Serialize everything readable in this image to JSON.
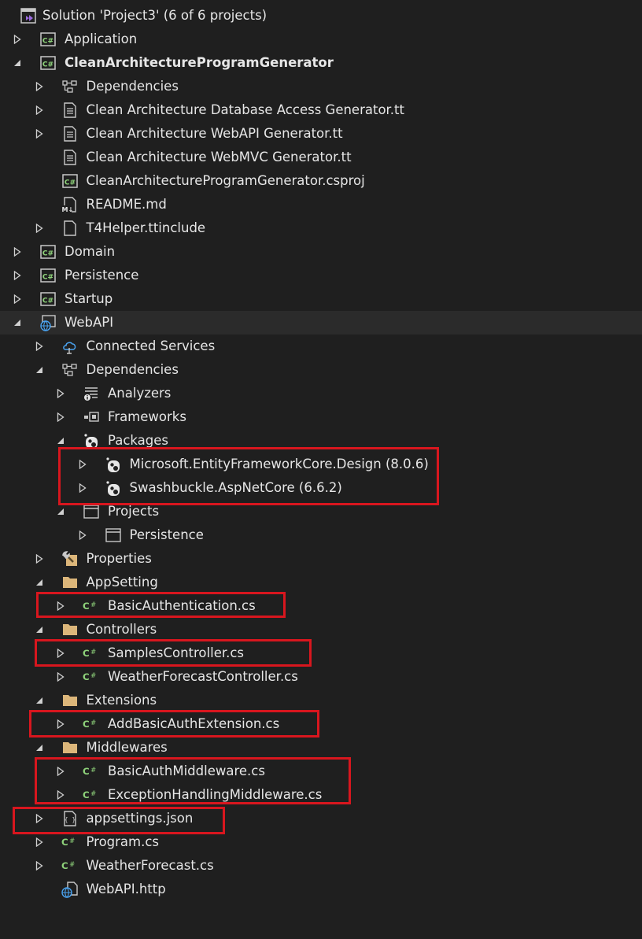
{
  "solution": {
    "label": "Solution 'Project3' (6 of 6 projects)"
  },
  "tree": [
    {
      "label": "Application",
      "indent": 1,
      "icon": "csharp-project-icon",
      "arrow": "collapsed"
    },
    {
      "label": "CleanArchitectureProgramGenerator",
      "indent": 1,
      "icon": "csharp-project-icon",
      "arrow": "expanded",
      "bold": true
    },
    {
      "label": "Dependencies",
      "indent": 2,
      "icon": "dependencies-icon",
      "arrow": "collapsed"
    },
    {
      "label": "Clean Architecture Database Access Generator.tt",
      "indent": 2,
      "icon": "text-template-icon",
      "arrow": "collapsed"
    },
    {
      "label": "Clean Architecture WebAPI Generator.tt",
      "indent": 2,
      "icon": "text-template-icon",
      "arrow": "collapsed"
    },
    {
      "label": "Clean Architecture WebMVC Generator.tt",
      "indent": 2,
      "icon": "text-template-icon",
      "arrow": "none"
    },
    {
      "label": "CleanArchitectureProgramGenerator.csproj",
      "indent": 2,
      "icon": "csharp-project-icon",
      "arrow": "none"
    },
    {
      "label": "README.md",
      "indent": 2,
      "icon": "markdown-icon",
      "arrow": "none"
    },
    {
      "label": "T4Helper.ttinclude",
      "indent": 2,
      "icon": "file-icon",
      "arrow": "collapsed"
    },
    {
      "label": "Domain",
      "indent": 1,
      "icon": "csharp-project-icon",
      "arrow": "collapsed"
    },
    {
      "label": "Persistence",
      "indent": 1,
      "icon": "csharp-project-icon",
      "arrow": "collapsed"
    },
    {
      "label": "Startup",
      "indent": 1,
      "icon": "csharp-project-icon",
      "arrow": "collapsed"
    },
    {
      "label": "WebAPI",
      "indent": 1,
      "icon": "web-project-icon",
      "arrow": "expanded",
      "selected": true
    },
    {
      "label": "Connected Services",
      "indent": 2,
      "icon": "connected-services-icon",
      "arrow": "collapsed"
    },
    {
      "label": "Dependencies",
      "indent": 2,
      "icon": "dependencies-icon",
      "arrow": "expanded"
    },
    {
      "label": "Analyzers",
      "indent": 3,
      "icon": "analyzers-icon",
      "arrow": "collapsed"
    },
    {
      "label": "Frameworks",
      "indent": 3,
      "icon": "frameworks-icon",
      "arrow": "collapsed"
    },
    {
      "label": "Packages",
      "indent": 3,
      "icon": "package-icon",
      "arrow": "expanded"
    },
    {
      "label": "Microsoft.EntityFrameworkCore.Design (8.0.6)",
      "indent": 4,
      "icon": "package-icon",
      "arrow": "collapsed"
    },
    {
      "label": "Swashbuckle.AspNetCore (6.6.2)",
      "indent": 4,
      "icon": "package-icon",
      "arrow": "collapsed"
    },
    {
      "label": "Projects",
      "indent": 3,
      "icon": "project-reference-icon",
      "arrow": "expanded"
    },
    {
      "label": "Persistence",
      "indent": 4,
      "icon": "project-reference-icon",
      "arrow": "collapsed"
    },
    {
      "label": "Properties",
      "indent": 2,
      "icon": "properties-wrench-icon",
      "arrow": "collapsed"
    },
    {
      "label": "AppSetting",
      "indent": 2,
      "icon": "folder-icon",
      "arrow": "expanded"
    },
    {
      "label": "BasicAuthentication.cs",
      "indent": 3,
      "icon": "csharp-file-icon",
      "arrow": "collapsed"
    },
    {
      "label": "Controllers",
      "indent": 2,
      "icon": "folder-icon",
      "arrow": "expanded"
    },
    {
      "label": "SamplesController.cs",
      "indent": 3,
      "icon": "csharp-file-icon",
      "arrow": "collapsed"
    },
    {
      "label": "WeatherForecastController.cs",
      "indent": 3,
      "icon": "csharp-file-icon",
      "arrow": "collapsed"
    },
    {
      "label": "Extensions",
      "indent": 2,
      "icon": "folder-icon",
      "arrow": "expanded"
    },
    {
      "label": "AddBasicAuthExtension.cs",
      "indent": 3,
      "icon": "csharp-file-icon",
      "arrow": "collapsed"
    },
    {
      "label": "Middlewares",
      "indent": 2,
      "icon": "folder-icon",
      "arrow": "expanded"
    },
    {
      "label": "BasicAuthMiddleware.cs",
      "indent": 3,
      "icon": "csharp-file-icon",
      "arrow": "collapsed"
    },
    {
      "label": "ExceptionHandlingMiddleware.cs",
      "indent": 3,
      "icon": "csharp-file-icon",
      "arrow": "collapsed"
    },
    {
      "label": "appsettings.json",
      "indent": 2,
      "icon": "json-file-icon",
      "arrow": "collapsed"
    },
    {
      "label": "Program.cs",
      "indent": 2,
      "icon": "csharp-file-icon",
      "arrow": "collapsed"
    },
    {
      "label": "WeatherForecast.cs",
      "indent": 2,
      "icon": "csharp-file-icon",
      "arrow": "collapsed"
    },
    {
      "label": "WebAPI.http",
      "indent": 2,
      "icon": "http-file-icon",
      "arrow": "none"
    }
  ],
  "colors": {
    "highlight": "#d8161e",
    "csharp": "#8fd37b",
    "folder": "#dcb67a",
    "background": "#1f1f1f",
    "text": "#e6e6e6",
    "vs_purple": "#9b6be0"
  }
}
